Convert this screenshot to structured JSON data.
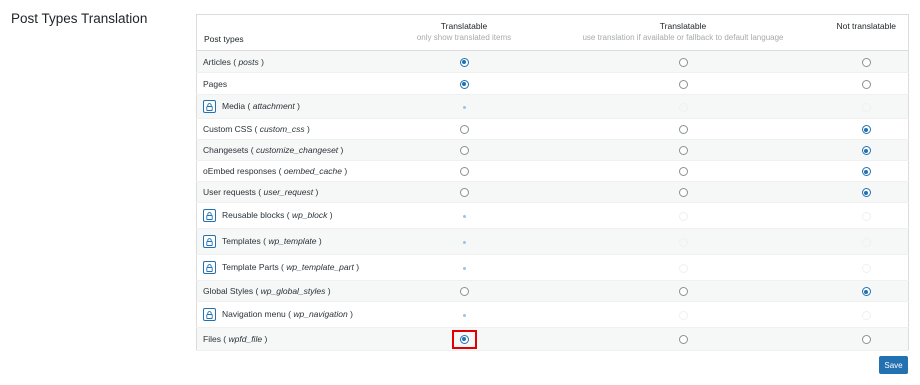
{
  "section_title": "Post Types Translation",
  "headers": {
    "post_types": "Post types",
    "translatable": "Translatable",
    "translatable_sub": "only show translated items",
    "fallback": "Translatable",
    "fallback_sub": "use translation if available or fallback to default language",
    "not_translatable": "Not translatable"
  },
  "rows": [
    {
      "label": "Articles (",
      "type": "posts",
      "close": " )",
      "locked": false,
      "selected": 0
    },
    {
      "label": "Pages",
      "type": "",
      "close": "",
      "locked": false,
      "selected": 0
    },
    {
      "label": "Media (",
      "type": "attachment",
      "close": " )",
      "locked": true,
      "selected": 0
    },
    {
      "label": "Custom CSS (",
      "type": "custom_css",
      "close": " )",
      "locked": false,
      "selected": 2
    },
    {
      "label": "Changesets (",
      "type": "customize_changeset",
      "close": " )",
      "locked": false,
      "selected": 2
    },
    {
      "label": "oEmbed responses (",
      "type": "oembed_cache",
      "close": " )",
      "locked": false,
      "selected": 2
    },
    {
      "label": "User requests (",
      "type": "user_request",
      "close": " )",
      "locked": false,
      "selected": 2
    },
    {
      "label": "Reusable blocks (",
      "type": "wp_block",
      "close": " )",
      "locked": true,
      "selected": 0
    },
    {
      "label": "Templates (",
      "type": "wp_template",
      "close": " )",
      "locked": true,
      "selected": 0
    },
    {
      "label": "Template Parts (",
      "type": "wp_template_part",
      "close": " )",
      "locked": true,
      "selected": 0
    },
    {
      "label": "Global Styles (",
      "type": "wp_global_styles",
      "close": " )",
      "locked": false,
      "selected": 2
    },
    {
      "label": "Navigation menu (",
      "type": "wp_navigation",
      "close": " )",
      "locked": true,
      "selected": 0
    },
    {
      "label": "Files (",
      "type": "wpfd_file",
      "close": " )",
      "locked": false,
      "selected": 0,
      "highlighted": true
    }
  ],
  "save_label": "Save",
  "colors": {
    "accent": "#2271b1",
    "highlight": "#e30000"
  }
}
